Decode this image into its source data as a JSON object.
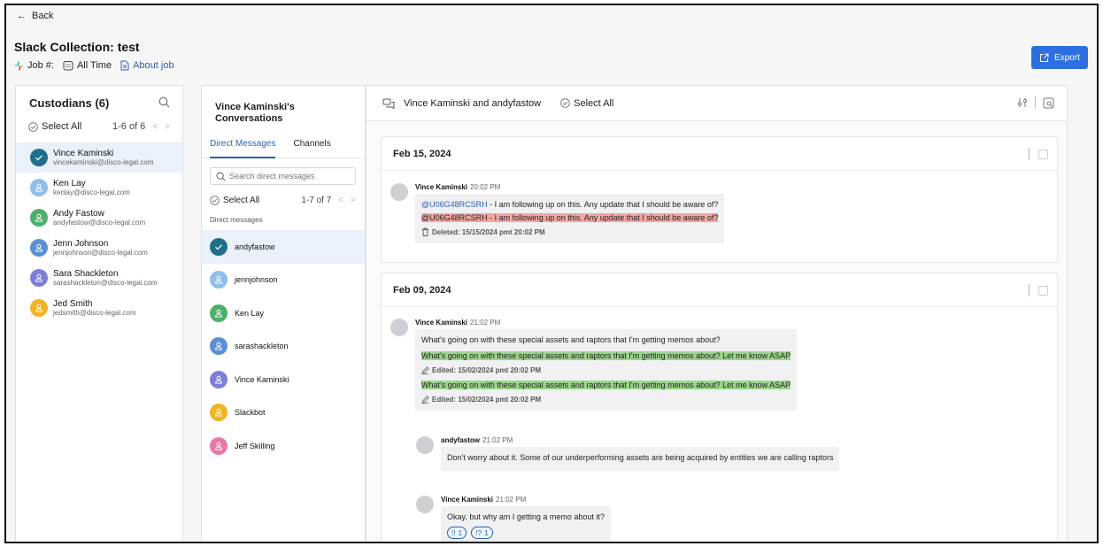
{
  "header": {
    "back_label": "Back",
    "title": "Slack Collection: test",
    "job_label": "Job #:",
    "time_label": "All Time",
    "about_label": "About job",
    "export_label": "Export"
  },
  "custodians": {
    "title": "Custodians (6)",
    "select_all": "Select All",
    "pager": "1-6 of 6",
    "items": [
      {
        "name": "Vince Kaminski",
        "email": "vincekaminski@disco-legal.com",
        "color": "#1f6f8b",
        "selected": true
      },
      {
        "name": "Ken Lay",
        "email": "kenlay@disco-legal.com",
        "color": "#8ebfe8"
      },
      {
        "name": "Andy Fastow",
        "email": "andyfastow@disco-legal.com",
        "color": "#4caf6a"
      },
      {
        "name": "Jenn Johnson",
        "email": "jennjohnson@disco-legal.com",
        "color": "#5b8fd4"
      },
      {
        "name": "Sara Shackleton",
        "email": "sarashackleton@disco-legal.com",
        "color": "#7b7fd9"
      },
      {
        "name": "Jed Smith",
        "email": "jedsmith@disco-legal.com",
        "color": "#f2b325"
      }
    ]
  },
  "conversations": {
    "title": "Vince Kaminski's Conversations",
    "tab_dm": "Direct Messages",
    "tab_channels": "Channels",
    "search_placeholder": "Search direct messages",
    "select_all": "Select All",
    "pager": "1-7 of 7",
    "section_label": "Direct messages",
    "items": [
      {
        "name": "andyfastow",
        "color": "#1f6f8b",
        "selected": true
      },
      {
        "name": "jennjohnson",
        "color": "#8ebfe8"
      },
      {
        "name": "Ken Lay",
        "color": "#4caf6a"
      },
      {
        "name": "sarashackleton",
        "color": "#5b8fd4"
      },
      {
        "name": "Vince Kaminski",
        "color": "#7b7fd9"
      },
      {
        "name": "Slackbot",
        "color": "#f2b325"
      },
      {
        "name": "Jeff Skilling",
        "color": "#e57aa8"
      }
    ]
  },
  "thread": {
    "title": "Vince Kaminski and andyfastow",
    "select_all": "Select All",
    "days": [
      {
        "date": "Feb 15, 2024",
        "messages": [
          {
            "author": "Vince Kaminski",
            "time": "20:02 PM",
            "mention": "@U06G48RCSRH",
            "text": " - I am following up on this. Any update that I should be aware of?",
            "deleted_mention": "@U06G48RCSRH",
            "deleted_text": " - I am following up on this. Any update that I should be aware of?",
            "deleted_note": "Deleted: 15/15/2024 pmt 20:02 PM"
          }
        ]
      },
      {
        "date": "Feb 09, 2024",
        "messages": [
          {
            "author": "Vince Kaminski",
            "time": "21:02 PM",
            "text": "What's going on with these special assets and raptors that I'm getting memos about?",
            "edit1": "What's going on with these special assets and raptors that I'm getting memos about? Let me know ASAP",
            "edit1_note": "Edited: 15/02/2024 pmt 20:02 PM",
            "edit2": "What's going on with these special assets and raptors that I'm getting memos about? Let me know ASAP",
            "edit2_note": "Edited: 15/02/2024 pmt 20:02 PM"
          },
          {
            "author": "andyfastow",
            "time": "21:02 PM",
            "text": "Don't worry about it. Some of our underperforming assets are being acquired by entities we are calling raptors"
          },
          {
            "author": "Vince Kaminski",
            "time": "21:02 PM",
            "text": "Okay, but why am I getting a memo about it?",
            "reactions": [
              {
                "emoji": "!!",
                "count": "1"
              },
              {
                "emoji": "!?",
                "count": "1"
              }
            ]
          }
        ]
      }
    ]
  }
}
